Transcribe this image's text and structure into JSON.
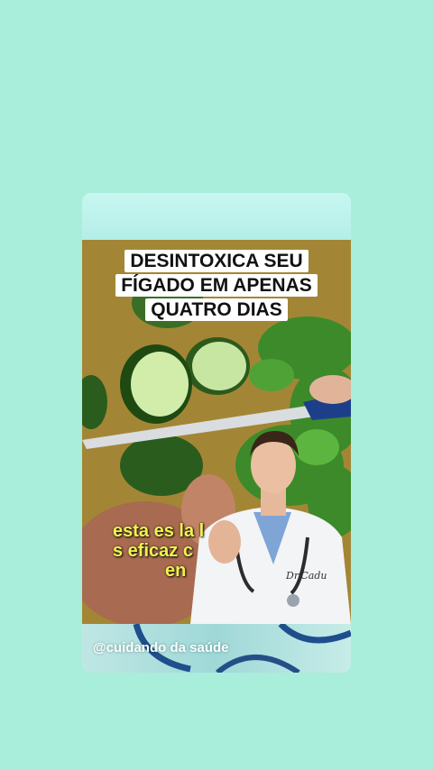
{
  "video": {
    "headline_lines": [
      "DESINTOXICA SEU",
      "FÍGADO EM APENAS",
      "QUATRO DIAS"
    ],
    "caption_lines": [
      "esta es la l",
      "s eficaz c",
      "en"
    ],
    "coat_label": "Dr.Cadu"
  },
  "footer": {
    "handle": "@cuidando da saúde"
  },
  "colors": {
    "background": "#a8eedb",
    "caption": "#f4f14a"
  }
}
